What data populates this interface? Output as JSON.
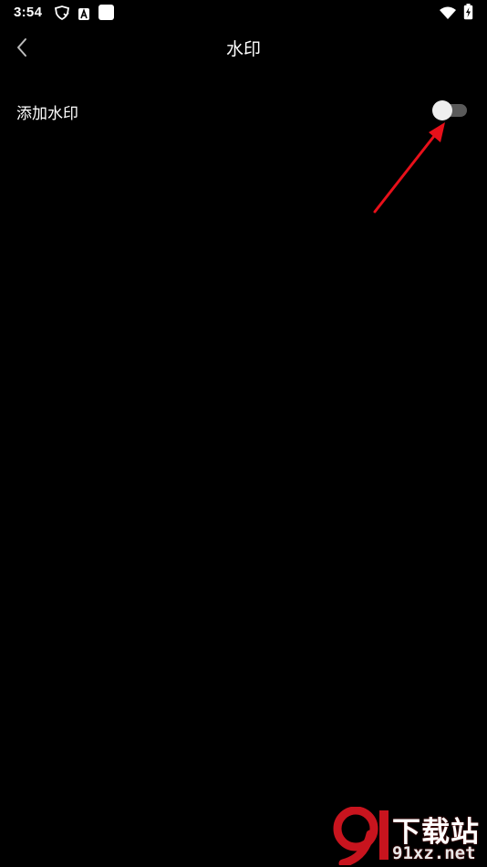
{
  "status_bar": {
    "time": "3:54",
    "icons": [
      "shield-icon",
      "a-icon",
      "square-icon",
      "wifi-icon",
      "battery-charging-icon"
    ]
  },
  "header": {
    "title": "水印",
    "back_icon": "chevron-left-icon"
  },
  "settings": {
    "add_watermark": {
      "label": "添加水印",
      "enabled": false
    }
  },
  "annotation": {
    "type": "arrow",
    "color": "#e8101a"
  },
  "site_watermark": {
    "logo": "9",
    "text_top": "下载站",
    "text_bottom": "91xz.net",
    "accent": "#c8141e"
  },
  "colors": {
    "background": "#000000",
    "text": "#ffffff",
    "toggle_track_off": "#5a5a5a",
    "toggle_thumb": "#eeeeee"
  }
}
